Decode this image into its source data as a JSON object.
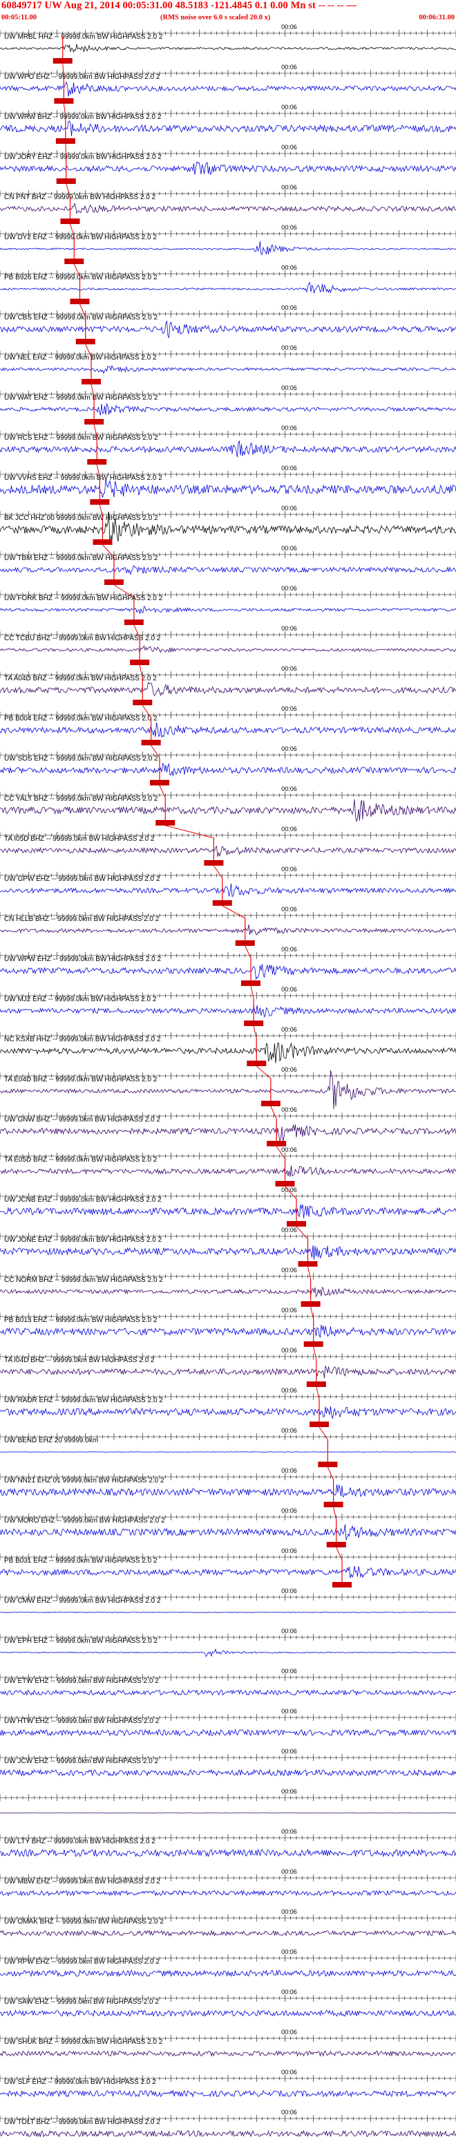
{
  "header": {
    "title": "60849717 UW Aug 21, 2014 00:05:31.00   48.5183 -121.4845  0.1 0.00 Mn st -- -- -- —",
    "subtitle": "(RMS noise over 6.0 s scaled 20.0 x)",
    "start_time": "00:05:11.00",
    "end_time": "00:06:31.00",
    "minute_mark": "00:06"
  },
  "chart_data": {
    "type": "line",
    "title": "60849717 UW Aug 21, 2014 00:05:31.00   48.5183 -121.4845  0.1 0.00 Mn st",
    "subtitle": "(RMS noise over 6.0 s scaled 20.0 x)",
    "x_start": "00:05:11.00",
    "x_end": "00:06:31.00",
    "x_range_s": [
      0,
      80
    ],
    "minute_mark_label": "00:06",
    "minute_mark_s": 49,
    "colors": {
      "pick": "#ee0000",
      "pick_box": "#cc0000",
      "trace_black": "#000000",
      "trace_blue": "#0000dd",
      "trace_purple": "#330066"
    },
    "traces": [
      {
        "label": "UW MRBL HHZ -- 99999.0km BW  HIGHPASS  2.0  2",
        "pick_s": 11.0,
        "amp": 0.12,
        "color": "black",
        "burst_s": 11.5,
        "burst_amp": 0.6
      },
      {
        "label": "UW WPO EHZ -- 99999.0km BW  HIGHPASS  2.0  2",
        "pick_s": 11.2,
        "amp": 0.25,
        "color": "blue",
        "burst_s": 11.5,
        "burst_amp": 0.7
      },
      {
        "label": "UW WRW BHZ -- 99999.0km BW  HIGHPASS  2.0  2",
        "pick_s": 11.5,
        "amp": 0.35,
        "color": "blue",
        "burst_s": 12.0,
        "burst_amp": 0.55
      },
      {
        "label": "UW JORY EHZ -- 99999.0km BW  HIGHPASS  2.0  2",
        "pick_s": 11.6,
        "amp": 0.3,
        "color": "blue",
        "burst_s": 34.0,
        "burst_amp": 0.7
      },
      {
        "label": "CN PNT BHZ -- 99999.0km BW  HIGHPASS  2.0  2",
        "pick_s": 12.3,
        "amp": 0.25,
        "color": "purple",
        "burst_s": 13.0,
        "burst_amp": 0.5
      },
      {
        "label": "UW DY2 EHZ -- 99999.0km BW  HIGHPASS  2.0  2",
        "pick_s": 13.0,
        "amp": 0.08,
        "color": "blue",
        "burst_s": 45.0,
        "burst_amp": 0.9
      },
      {
        "label": "PB B926 EHZ -- 99999.0km BW  HIGHPASS  2.0  2",
        "pick_s": 14.0,
        "amp": 0.1,
        "color": "blue",
        "burst_s": 54.0,
        "burst_amp": 0.9
      },
      {
        "label": "UW CBS EHZ -- 99999.0km BW  HIGHPASS  2.0  2",
        "pick_s": 15.0,
        "amp": 0.3,
        "color": "blue",
        "burst_s": 29.0,
        "burst_amp": 0.7
      },
      {
        "label": "UW NEL EHZ -- 99999.0km BW  HIGHPASS  2.0  2",
        "pick_s": 16.0,
        "amp": 0.15,
        "color": "blue",
        "burst_s": 17.0,
        "burst_amp": 0.5
      },
      {
        "label": "UW WAT EHZ -- 99999.0km BW  HIGHPASS  2.0  2",
        "pick_s": 16.5,
        "amp": 0.2,
        "color": "blue",
        "burst_s": 17.5,
        "burst_amp": 0.55
      },
      {
        "label": "UW RCS EHZ -- 99999.0km BW  HIGHPASS  2.0  2",
        "pick_s": 17.0,
        "amp": 0.3,
        "color": "blue",
        "burst_s": 41.0,
        "burst_amp": 0.8
      },
      {
        "label": "UW VVHS EHZ -- 99999.0km BW  HIGHPASS  2.0  2",
        "pick_s": 17.5,
        "amp": 0.45,
        "color": "blue",
        "burst_s": 18.0,
        "burst_amp": 0.8
      },
      {
        "label": "BK JCC HHZ 00 99999.0km BW  HIGHPASS  2.0  2",
        "pick_s": 18.0,
        "amp": 0.4,
        "color": "black",
        "burst_s": 19.0,
        "burst_amp": 1.5
      },
      {
        "label": "UW TBM EHZ -- 99999.0km BW  HIGHPASS  2.0  2",
        "pick_s": 20.0,
        "amp": 0.25,
        "color": "blue",
        "burst_s": 22.0,
        "burst_amp": 0.4
      },
      {
        "label": "UW FORK BHZ -- 99999.0km BW  HIGHPASS  2.0  2",
        "pick_s": 23.5,
        "amp": 0.15,
        "color": "blue",
        "burst_s": 24.0,
        "burst_amp": 0.4
      },
      {
        "label": "CC TCBU BHZ -- 99999.0km BW  HIGHPASS  2.0  2",
        "pick_s": 24.5,
        "amp": 0.15,
        "color": "purple",
        "burst_s": 25.0,
        "burst_amp": 0.35
      },
      {
        "label": "TA A04D BHZ -- 99999.0km BW  HIGHPASS  2.0  2",
        "pick_s": 25.0,
        "amp": 0.3,
        "color": "purple",
        "burst_s": 26.0,
        "burst_amp": 0.6
      },
      {
        "label": "PB B004 EHZ -- 99999.0km BW  HIGHPASS  2.0  2",
        "pick_s": 26.5,
        "amp": 0.3,
        "color": "blue",
        "burst_s": 27.0,
        "burst_amp": 0.7
      },
      {
        "label": "UW SOS EHZ -- 99999.0km BW  HIGHPASS  2.0  2",
        "pick_s": 28.0,
        "amp": 0.3,
        "color": "blue",
        "burst_s": 28.5,
        "burst_amp": 0.5
      },
      {
        "label": "CC YALT BHZ -- 99999.0km BW  HIGHPASS  2.0  2",
        "pick_s": 29.0,
        "amp": 0.35,
        "color": "purple",
        "burst_s": 62.0,
        "burst_amp": 1.2
      },
      {
        "label": "TA I05D BHZ -- 99999.0km BW  HIGHPASS  2.0  2",
        "pick_s": 37.5,
        "amp": 0.25,
        "color": "purple",
        "burst_s": 38.0,
        "burst_amp": 0.5
      },
      {
        "label": "UW GPW EHZ -- 99999.0km BW  HIGHPASS  2.0  2",
        "pick_s": 39.0,
        "amp": 0.25,
        "color": "blue",
        "burst_s": 39.5,
        "burst_amp": 0.7
      },
      {
        "label": "CN HLLB BHZ -- 99999.0km BW  HIGHPASS  2.0  2",
        "pick_s": 43.0,
        "amp": 0.2,
        "color": "purple",
        "burst_s": 43.5,
        "burst_amp": 0.5
      },
      {
        "label": "UW WPW EHZ -- 99999.0km BW  HIGHPASS  2.0  2",
        "pick_s": 44.0,
        "amp": 0.3,
        "color": "blue",
        "burst_s": 44.5,
        "burst_amp": 0.7
      },
      {
        "label": "UW MJ2 EHZ -- 99999.0km BW  HIGHPASS  2.0  2",
        "pick_s": 44.5,
        "amp": 0.25,
        "color": "blue",
        "burst_s": 45.0,
        "burst_amp": 0.6
      },
      {
        "label": "NC KSXB HHZ -- 99999.0km BW  HIGHPASS  2.0  2",
        "pick_s": 45.0,
        "amp": 0.3,
        "color": "black",
        "burst_s": 47.0,
        "burst_amp": 1.6
      },
      {
        "label": "TA E04D BHZ -- 99999.0km BW  HIGHPASS  2.0  2",
        "pick_s": 47.5,
        "amp": 0.2,
        "color": "purple",
        "burst_s": 58.0,
        "burst_amp": 2.0
      },
      {
        "label": "UW GNW BHZ -- 99999.0km BW  HIGHPASS  2.0  2",
        "pick_s": 48.5,
        "amp": 0.3,
        "color": "purple",
        "burst_s": 49.0,
        "burst_amp": 0.9
      },
      {
        "label": "TA E05D BHZ -- 99999.0km BW  HIGHPASS  2.0  2",
        "pick_s": 50.0,
        "amp": 0.25,
        "color": "purple",
        "burst_s": 50.5,
        "burst_amp": 0.5
      },
      {
        "label": "UW JCNB EHZ -- 99999.0km BW  HIGHPASS  2.0  2",
        "pick_s": 52.0,
        "amp": 0.35,
        "color": "blue",
        "burst_s": 52.5,
        "burst_amp": 0.5
      },
      {
        "label": "UW JONE EHZ -- 99999.0km BW  HIGHPASS  2.0  2",
        "pick_s": 54.0,
        "amp": 0.35,
        "color": "blue",
        "burst_s": 54.5,
        "burst_amp": 0.6
      },
      {
        "label": "CC NORM BHZ -- 99999.0km BW  HIGHPASS  2.0  2",
        "pick_s": 54.5,
        "amp": 0.2,
        "color": "purple",
        "burst_s": 55.0,
        "burst_amp": 0.4
      },
      {
        "label": "PB B013 EHZ -- 99999.0km BW  HIGHPASS  2.0  2",
        "pick_s": 55.0,
        "amp": 0.35,
        "color": "blue",
        "burst_s": 55.5,
        "burst_amp": 0.5
      },
      {
        "label": "TA I04D BHZ -- 99999.0km BW  HIGHPASS  2.0  2",
        "pick_s": 55.5,
        "amp": 0.3,
        "color": "purple",
        "burst_s": 56.0,
        "burst_amp": 0.5
      },
      {
        "label": "UW RADR EHZ -- 99999.0km BW  HIGHPASS  2.0  2",
        "pick_s": 56.0,
        "amp": 0.35,
        "color": "blue",
        "burst_s": 56.5,
        "burst_amp": 0.6
      },
      {
        "label": "UW BEND EHZ 20 99999.0km",
        "pick_s": 57.5,
        "amp": 0.02,
        "color": "blue",
        "burst_s": 0,
        "burst_amp": 0.0
      },
      {
        "label": "UW NN21 EHZ 01 99999.0km BW  HIGHPASS  2.0  2",
        "pick_s": 58.5,
        "amp": 0.35,
        "color": "blue",
        "burst_s": 59.0,
        "burst_amp": 0.5
      },
      {
        "label": "UW MORO EHZ -- 99999.0km BW  HIGHPASS  2.0  2",
        "pick_s": 59.0,
        "amp": 0.35,
        "color": "blue",
        "burst_s": 60.0,
        "burst_amp": 0.6
      },
      {
        "label": "PB B031 EHZ -- 99999.0km BW  HIGHPASS  2.0  2",
        "pick_s": 60.0,
        "amp": 0.3,
        "color": "blue",
        "burst_s": 61.0,
        "burst_amp": 0.6
      },
      {
        "label": "UW CMW EHZ -- 99999.0km BW  HIGHPASS  2.0  2",
        "pick_s": null,
        "amp": 0.03,
        "color": "blue",
        "burst_s": 0,
        "burst_amp": 0.0
      },
      {
        "label": "UW EPH EHZ -- 99999.0km BW  HIGHPASS  2.0  2",
        "pick_s": null,
        "amp": 0.05,
        "color": "blue",
        "burst_s": 36.0,
        "burst_amp": 0.5
      },
      {
        "label": "UW ETW EHZ -- 99999.0km BW  HIGHPASS  2.0  2",
        "pick_s": null,
        "amp": 0.25,
        "color": "blue",
        "burst_s": 0,
        "burst_amp": 0.0
      },
      {
        "label": "UW HTW EHZ -- 99999.0km BW  HIGHPASS  2.0  2",
        "pick_s": null,
        "amp": 0.3,
        "color": "blue",
        "burst_s": 0,
        "burst_amp": 0.0
      },
      {
        "label": "UW JCW EHZ -- 99999.0km BW  HIGHPASS  2.0  2",
        "pick_s": null,
        "amp": 0.3,
        "color": "blue",
        "burst_s": 0,
        "burst_amp": 0.0
      },
      {
        "label": "",
        "pick_s": null,
        "amp": 0.01,
        "color": "purple",
        "burst_s": 0,
        "burst_amp": 0.0
      },
      {
        "label": "UW LTY BHZ -- 99999.0km BW  HIGHPASS  2.0  2",
        "pick_s": null,
        "amp": 0.35,
        "color": "blue",
        "burst_s": 0,
        "burst_amp": 0.0
      },
      {
        "label": "UW MBW EHZ -- 99999.0km BW  HIGHPASS  2.0  2",
        "pick_s": null,
        "amp": 0.25,
        "color": "blue",
        "burst_s": 0,
        "burst_amp": 0.0
      },
      {
        "label": "UW OMAK BHZ -- 99999.0km BW  HIGHPASS  2.0  2",
        "pick_s": null,
        "amp": 0.25,
        "color": "purple",
        "burst_s": 0,
        "burst_amp": 0.0
      },
      {
        "label": "UW RPW EHZ -- 99999.0km BW  HIGHPASS  2.0  2",
        "pick_s": null,
        "amp": 0.3,
        "color": "blue",
        "burst_s": 0,
        "burst_amp": 0.0
      },
      {
        "label": "UW SAW EHZ -- 99999.0km BW  HIGHPASS  2.0  2",
        "pick_s": null,
        "amp": 0.3,
        "color": "blue",
        "burst_s": 0,
        "burst_amp": 0.0
      },
      {
        "label": "UW SHUK BHZ -- 99999.0km BW  HIGHPASS  2.0  2",
        "pick_s": null,
        "amp": 0.25,
        "color": "purple",
        "burst_s": 0,
        "burst_amp": 0.0
      },
      {
        "label": "UW SLF EHZ -- 99999.0km BW  HIGHPASS  2.0  2",
        "pick_s": null,
        "amp": 0.3,
        "color": "blue",
        "burst_s": 0,
        "burst_amp": 0.0
      },
      {
        "label": "UW TOLT BHZ -- 99999.0km BW  HIGHPASS  2.0  2",
        "pick_s": null,
        "amp": 0.3,
        "color": "purple",
        "burst_s": 0,
        "burst_amp": 0.0
      }
    ]
  }
}
